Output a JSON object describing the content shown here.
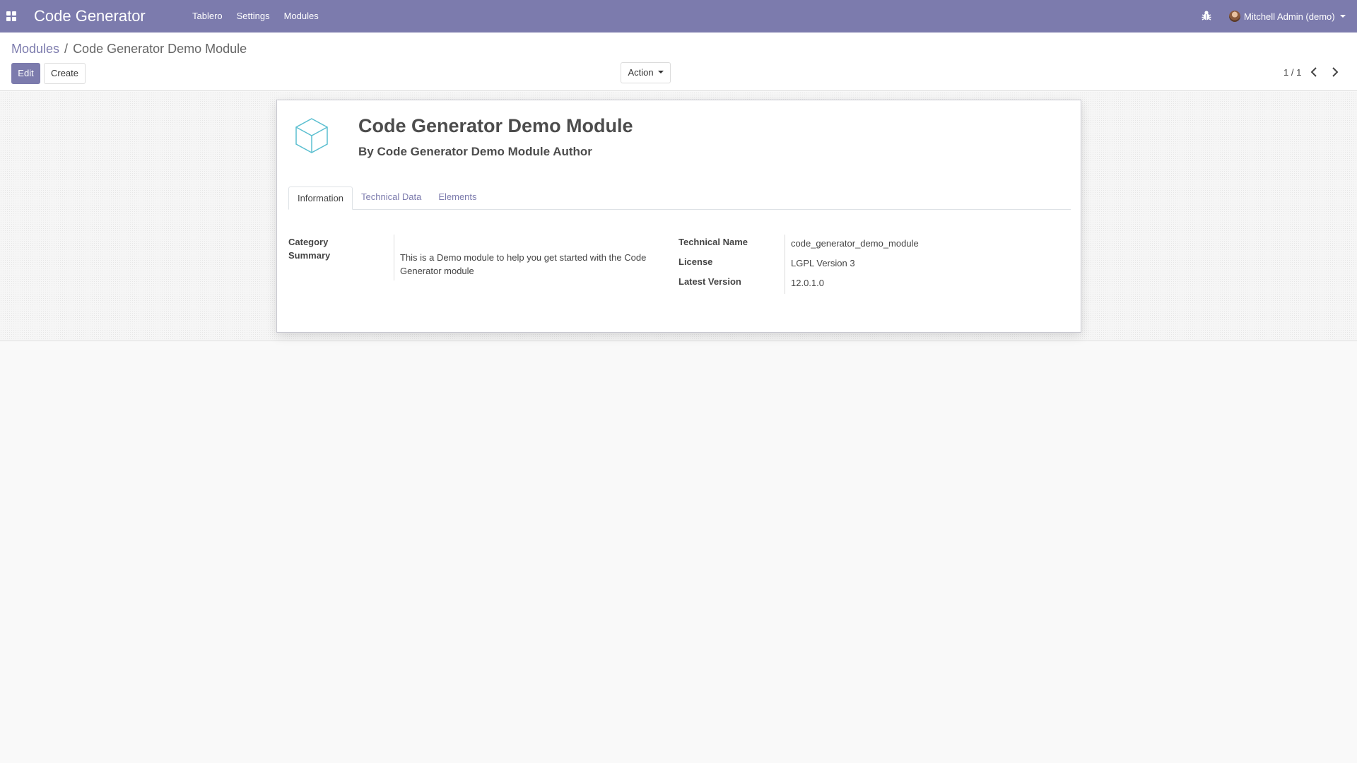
{
  "navbar": {
    "apps_icon": "grid-icon",
    "brand": "Code Generator",
    "menu": [
      {
        "label": "Tablero"
      },
      {
        "label": "Settings"
      },
      {
        "label": "Modules"
      }
    ],
    "debug_icon": "bug-icon",
    "user": "Mitchell Admin (demo)"
  },
  "breadcrumb": {
    "parent": "Modules",
    "separator": "/",
    "current": "Code Generator Demo Module"
  },
  "buttons": {
    "edit": "Edit",
    "create": "Create",
    "action": "Action"
  },
  "pager": {
    "value": "1 / 1"
  },
  "record": {
    "icon": "cube-icon",
    "title": "Code Generator Demo Module",
    "author": "By Code Generator Demo Module Author",
    "tabs": [
      {
        "label": "Information",
        "active": true
      },
      {
        "label": "Technical Data",
        "active": false
      },
      {
        "label": "Elements",
        "active": false
      }
    ],
    "left_fields": {
      "category_label": "Category",
      "category_value": "",
      "summary_label": "Summary",
      "summary_value": "This is a Demo module to help you get started with the Code Generator module"
    },
    "right_fields": {
      "technical_name_label": "Technical Name",
      "technical_name_value": "code_generator_demo_module",
      "license_label": "License",
      "license_value": "LGPL Version 3",
      "latest_version_label": "Latest Version",
      "latest_version_value": "12.0.1.0"
    }
  },
  "colors": {
    "brand": "#7c7bad",
    "icon_teal": "#5bbfd0"
  }
}
